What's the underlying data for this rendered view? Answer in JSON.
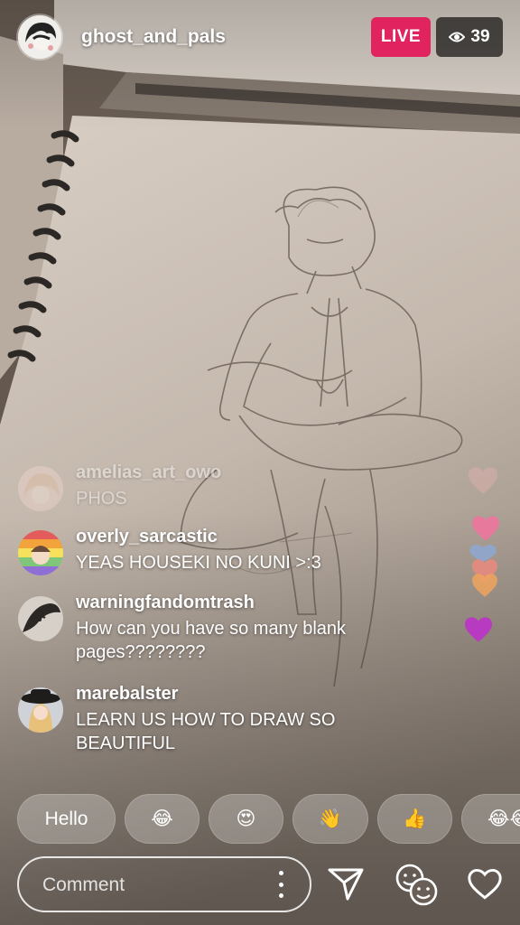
{
  "header": {
    "host_name": "ghost_and_pals",
    "live_label": "LIVE",
    "viewer_count": "39"
  },
  "comments": [
    {
      "username": "amelias_art_owo",
      "text": "PHOS",
      "faded": true
    },
    {
      "username": "overly_sarcastic",
      "text": "YEAS HOUSEKI NO KUNI >:3",
      "faded": false
    },
    {
      "username": "warningfandomtrash",
      "text": "How can you have so many blank pages????????",
      "faded": false
    },
    {
      "username": "marebalster",
      "text": "LEARN US HOW TO DRAW SO BEAUTIFUL",
      "faded": false
    }
  ],
  "quick_replies": [
    "Hello",
    "😂",
    "😍",
    "👋",
    "👍",
    "😂😂"
  ],
  "comment_box": {
    "placeholder": "Comment"
  },
  "icons": {
    "viewer": "eye-icon",
    "more": "more-vertical-icon",
    "send": "send-icon",
    "faces": "faces-icon",
    "like": "heart-icon"
  },
  "colors": {
    "live_badge": "#e1245f",
    "hearts": [
      "#f0b5b3",
      "#e7799c",
      "#8ca9d6",
      "#ec8a7e",
      "#f0a45e",
      "#b83ac0"
    ]
  }
}
